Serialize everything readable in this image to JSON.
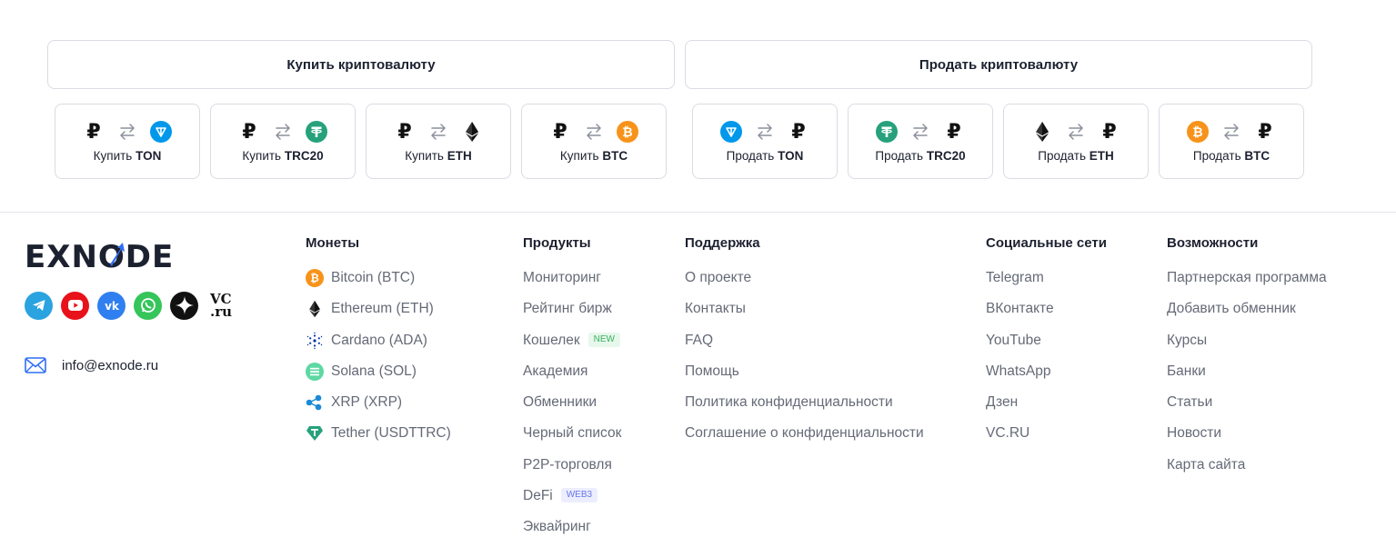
{
  "top_buttons": {
    "buy_label": "Купить криптовалюту",
    "sell_label": "Продать криптовалюту"
  },
  "buy_pairs": [
    {
      "action": "Купить",
      "coin": "TON"
    },
    {
      "action": "Купить",
      "coin": "TRC20"
    },
    {
      "action": "Купить",
      "coin": "ETH"
    },
    {
      "action": "Купить",
      "coin": "BTC"
    }
  ],
  "sell_pairs": [
    {
      "action": "Продать",
      "coin": "TON"
    },
    {
      "action": "Продать",
      "coin": "TRC20"
    },
    {
      "action": "Продать",
      "coin": "ETH"
    },
    {
      "action": "Продать",
      "coin": "BTC"
    }
  ],
  "rub_symbol": "₽",
  "logo": {
    "text": "EXNODE"
  },
  "socials": {
    "vc_line1": "VC",
    "vc_line2": ".ru"
  },
  "email": "info@exnode.ru",
  "columns": {
    "coins": {
      "title": "Монеты",
      "items": [
        "Bitcoin (BTC)",
        "Ethereum (ETH)",
        "Cardano (ADA)",
        "Solana (SOL)",
        "XRP (XRP)",
        "Tether (USDTTRC)"
      ]
    },
    "products": {
      "title": "Продукты",
      "items": [
        "Мониторинг",
        "Рейтинг бирж",
        "Кошелек",
        "Академия",
        "Обменники",
        "Черный список",
        "P2P-торговля",
        "DeFi",
        "Эквайринг"
      ],
      "badge_new": "NEW",
      "badge_web3": "WEB3"
    },
    "support": {
      "title": "Поддержка",
      "items": [
        "О проекте",
        "Контакты",
        "FAQ",
        "Помощь",
        "Политика конфиденциальности",
        "Соглашение о конфиденциальности"
      ]
    },
    "social": {
      "title": "Социальные сети",
      "items": [
        "Telegram",
        "ВКонтакте",
        "YouTube",
        "WhatsApp",
        "Дзен",
        "VC.RU"
      ]
    },
    "features": {
      "title": "Возможности",
      "items": [
        "Партнерская программа",
        "Добавить обменник",
        "Курсы",
        "Банки",
        "Статьи",
        "Новости",
        "Карта сайта"
      ]
    }
  },
  "colors": {
    "ton": "#0098ea",
    "usdt": "#26a17b",
    "btc": "#f7931a",
    "text": "#1c2130",
    "muted": "#656a77"
  }
}
